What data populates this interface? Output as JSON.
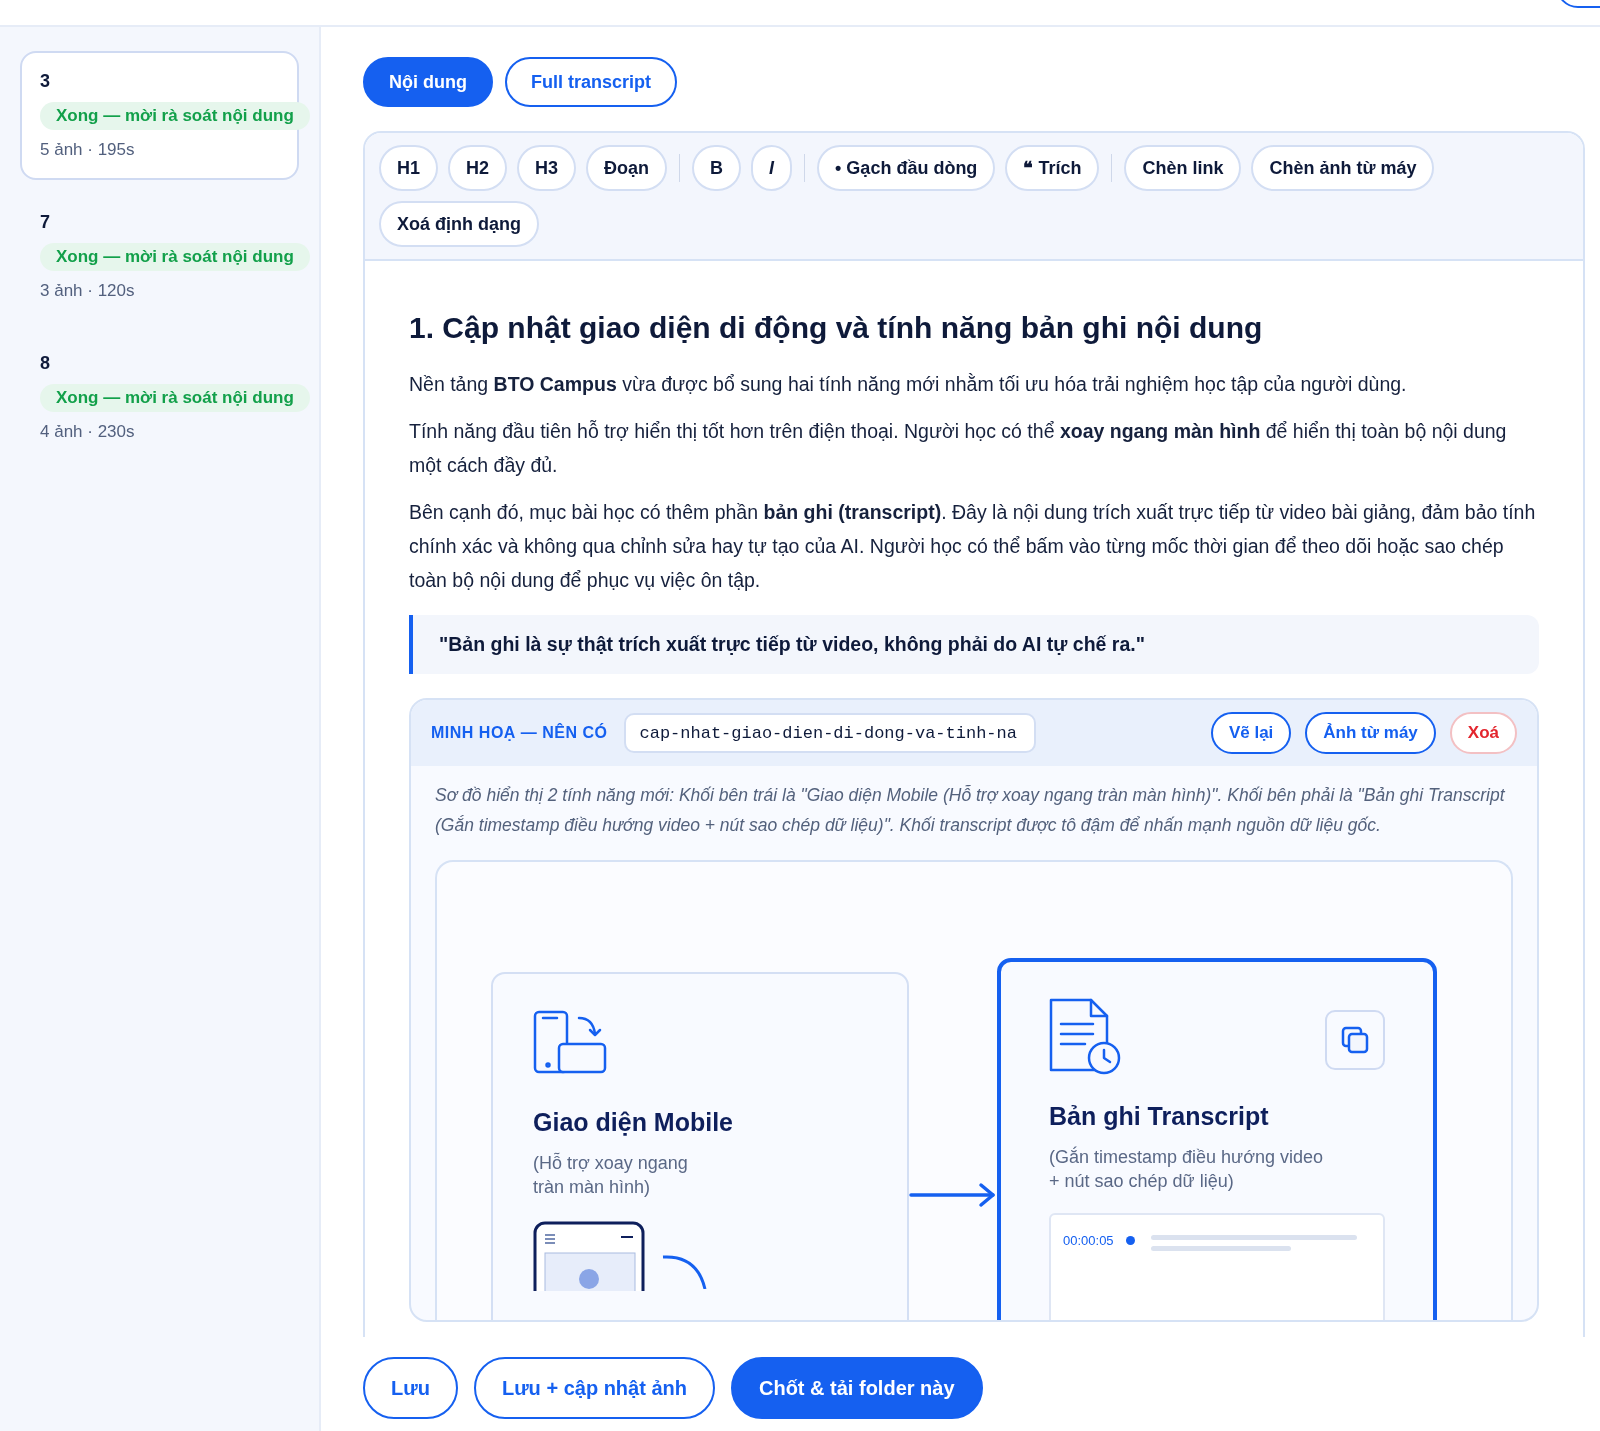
{
  "sidebar": {
    "items": [
      {
        "number": "3",
        "status": "Xong — mời rà soát nội dung",
        "meta": "5 ảnh · 195s",
        "selected": true
      },
      {
        "number": "7",
        "status": "Xong — mời rà soát nội dung",
        "meta": "3 ảnh · 120s",
        "selected": false
      },
      {
        "number": "8",
        "status": "Xong — mời rà soát nội dung",
        "meta": "4 ảnh · 230s",
        "selected": false
      }
    ]
  },
  "tabs": [
    {
      "label": "Nội dung",
      "selected": true
    },
    {
      "label": "Full transcript",
      "selected": false
    }
  ],
  "toolbar": {
    "groups": [
      [
        {
          "label": "H1",
          "kind": "plain"
        },
        {
          "label": "H2",
          "kind": "plain"
        },
        {
          "label": "H3",
          "kind": "plain"
        },
        {
          "label": "Đoạn",
          "kind": "plain"
        }
      ],
      [
        {
          "label": "B",
          "kind": "plain"
        },
        {
          "label": "I",
          "kind": "italic"
        }
      ],
      [
        {
          "label": "• Gạch đầu dòng",
          "kind": "plain"
        },
        {
          "label": "❝ Trích",
          "kind": "plain"
        }
      ],
      [
        {
          "label": "Chèn link",
          "kind": "plain"
        },
        {
          "label": "Chèn ảnh từ máy",
          "kind": "plain"
        },
        {
          "label": "Xoá định dạng",
          "kind": "plain"
        }
      ]
    ]
  },
  "document": {
    "heading": "1. Cập nhật giao diện di động và tính năng bản ghi nội dung",
    "paragraphs": [
      "Nền tảng **BTO Campus** vừa được bổ sung hai tính năng mới nhằm tối ưu hóa trải nghiệm học tập của người dùng.",
      "Tính năng đầu tiên hỗ trợ hiển thị tốt hơn trên điện thoại. Người học có thể **xoay ngang màn hình** để hiển thị toàn bộ nội dung một cách đầy đủ.",
      "Bên cạnh đó, mục bài học có thêm phần **bản ghi (transcript)**. Đây là nội dung trích xuất trực tiếp từ video bài giảng, đảm bảo tính chính xác và không qua chỉnh sửa hay tự tạo của AI. Người học có thể bấm vào từng mốc thời gian để theo dõi hoặc sao chép toàn bộ nội dung để phục vụ việc ôn tập."
    ],
    "quote": "\"Bản ghi là sự thật trích xuất trực tiếp từ video, không phải do AI tự chế ra.\"",
    "illustration": {
      "label": "MINH HOẠ — NÊN CÓ",
      "filename": "cap-nhat-giao-dien-di-dong-va-tinh-na",
      "buttons": [
        {
          "label": "Vẽ lại",
          "kind": "normal"
        },
        {
          "label": "Ảnh từ máy",
          "kind": "normal"
        },
        {
          "label": "Xoá",
          "kind": "danger"
        }
      ],
      "caption": "Sơ đồ hiển thị 2 tính năng mới: Khối bên trái là \"Giao diện Mobile (Hỗ trợ xoay ngang tràn màn hình)\". Khối bên phải là \"Bản ghi Transcript (Gắn timestamp điều hướng video + nút sao chép dữ liệu)\". Khối transcript được tô đậm để nhấn mạnh nguồn dữ liệu gốc.",
      "diagram": {
        "left": {
          "title": "Giao diện Mobile",
          "subtitle_lines": [
            "(Hỗ trợ xoay ngang",
            "tràn màn hình)"
          ]
        },
        "right": {
          "title": "Bản ghi Transcript",
          "subtitle_lines": [
            "(Gắn timestamp điều hướng video",
            "+ nút sao chép dữ liệu)"
          ],
          "timestamp": "00:00:05"
        }
      }
    }
  },
  "actions": [
    {
      "label": "Lưu",
      "kind": "outline"
    },
    {
      "label": "Lưu + cập nhật ảnh",
      "kind": "outline"
    },
    {
      "label": "Chốt & tải folder này",
      "kind": "primary"
    }
  ]
}
